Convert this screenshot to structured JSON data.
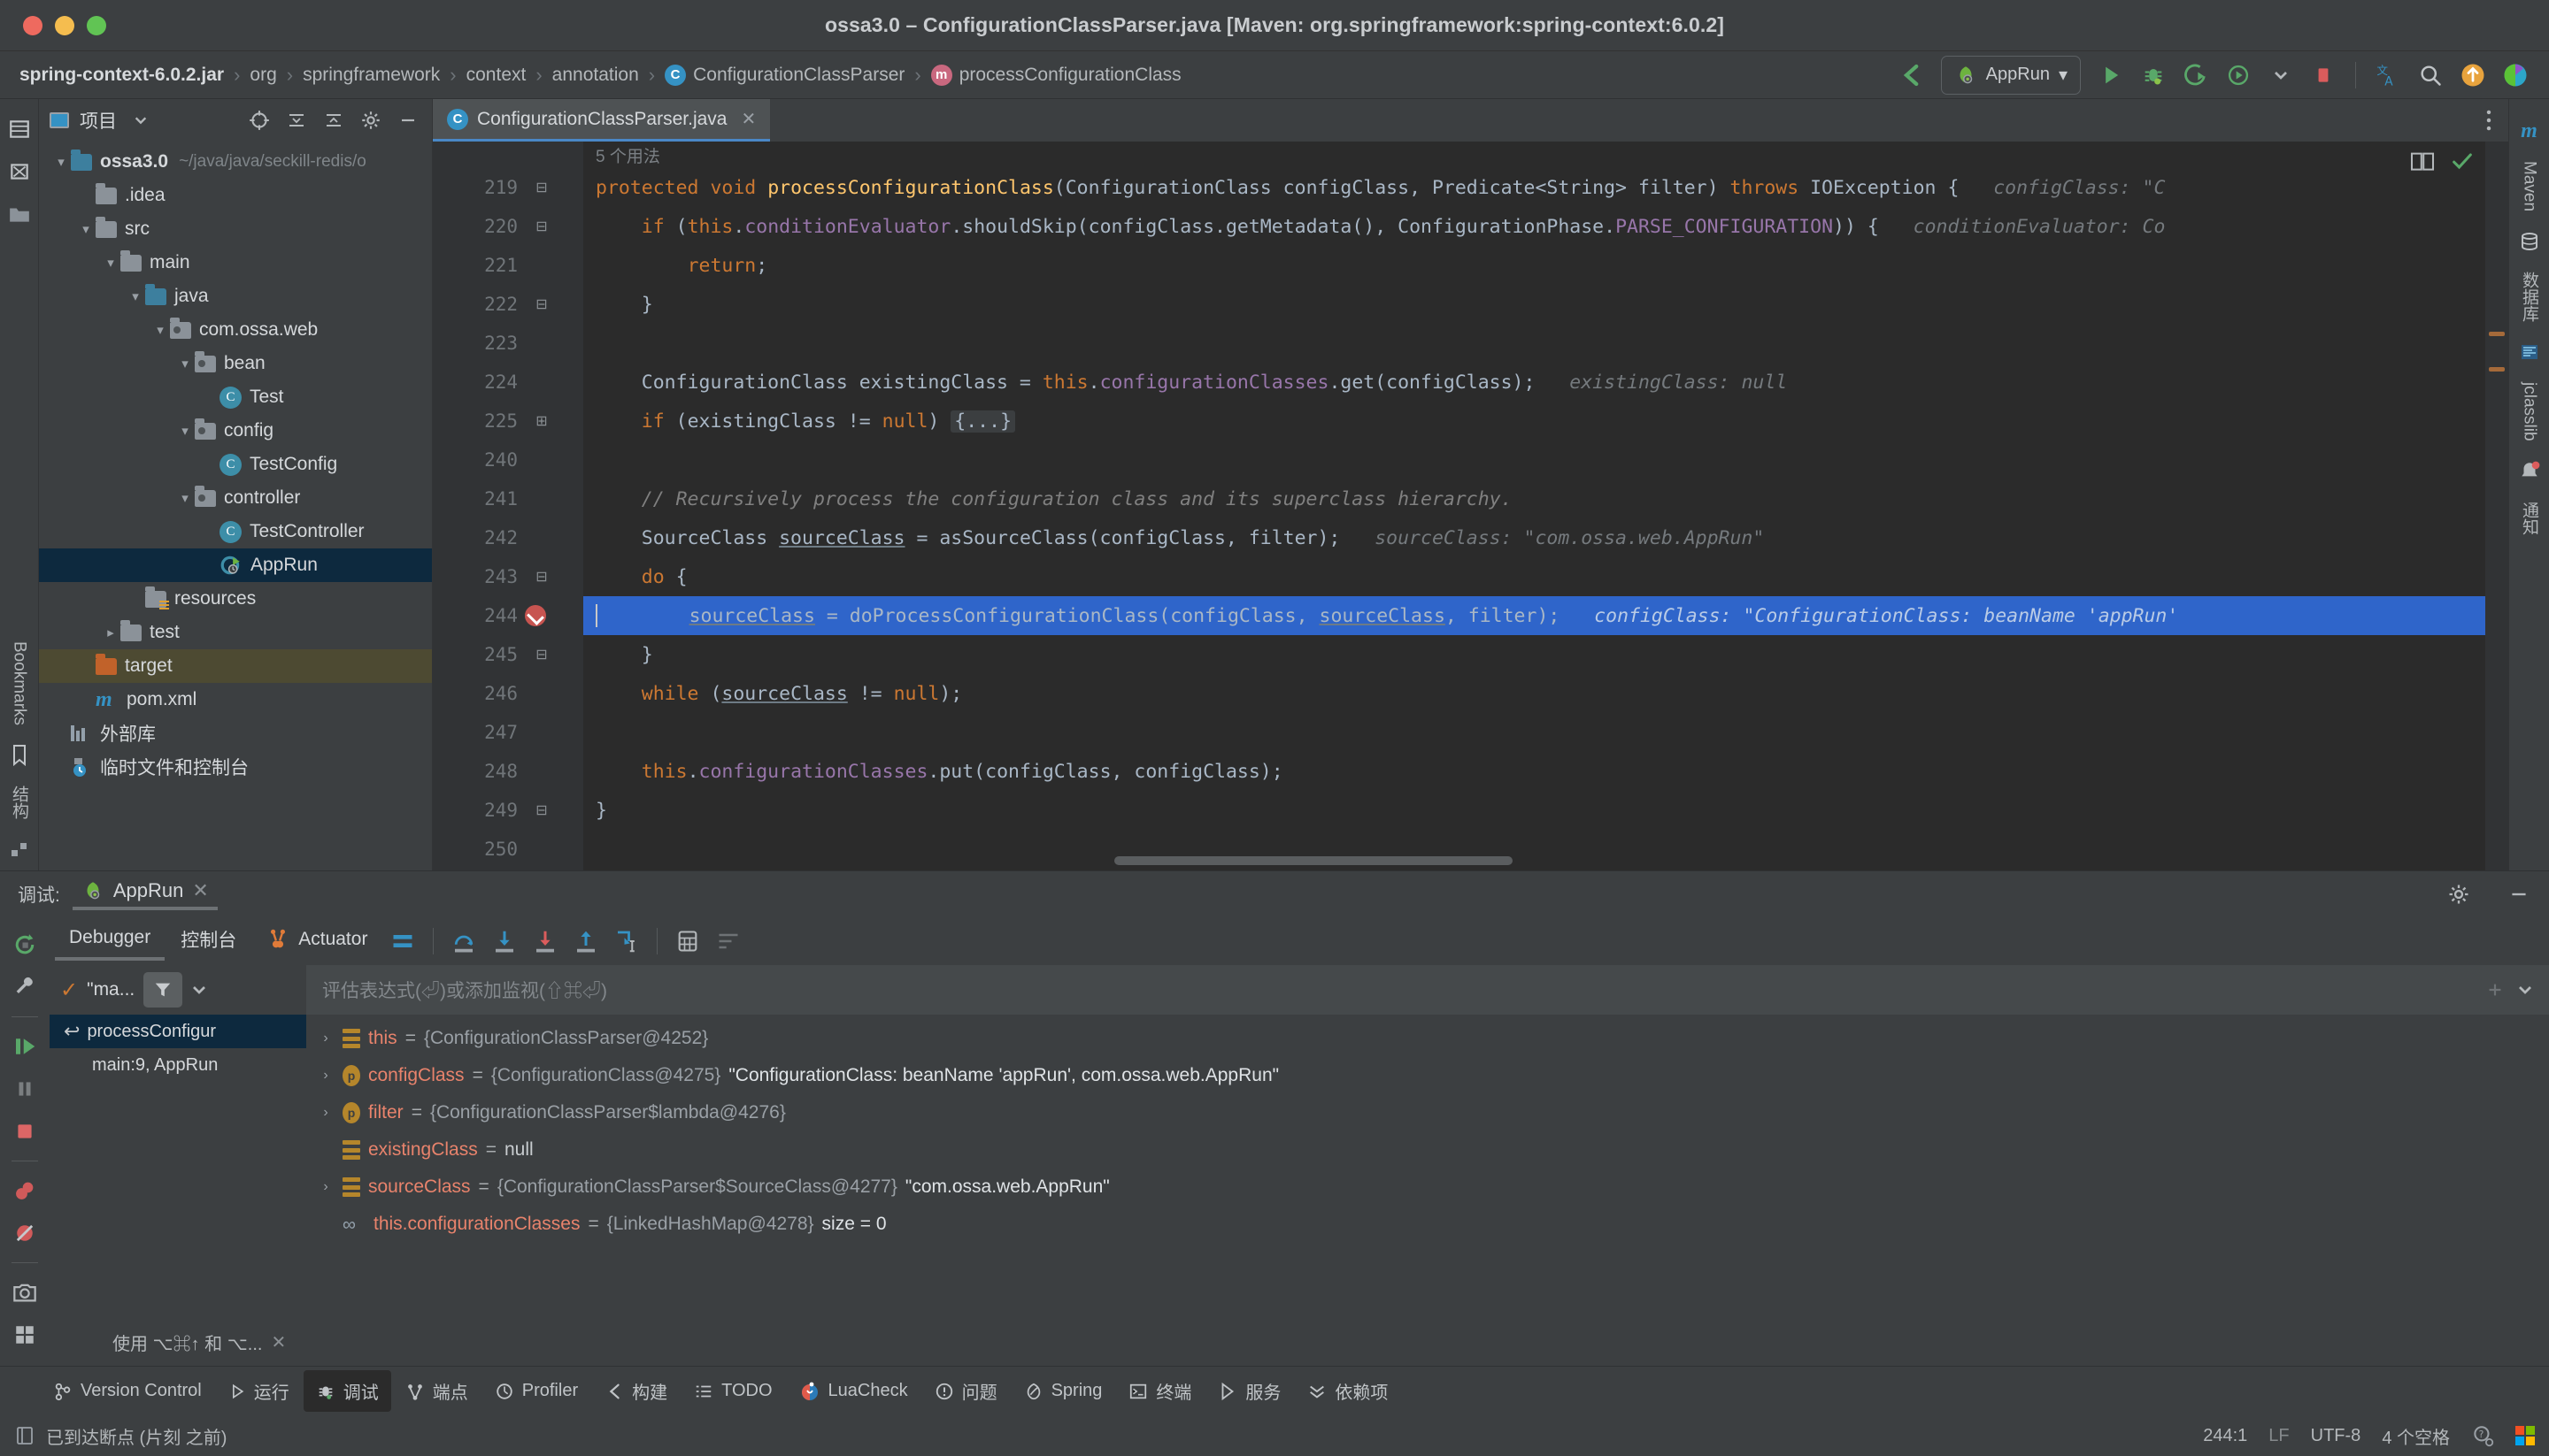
{
  "window": {
    "title": "ossa3.0 – ConfigurationClassParser.java [Maven: org.springframework:spring-context:6.0.2]"
  },
  "breadcrumbs": [
    {
      "label": "spring-context-6.0.2.jar",
      "icon": ""
    },
    {
      "label": "org",
      "icon": ""
    },
    {
      "label": "springframework",
      "icon": ""
    },
    {
      "label": "context",
      "icon": ""
    },
    {
      "label": "annotation",
      "icon": ""
    },
    {
      "label": "ConfigurationClassParser",
      "icon": "class-icon"
    },
    {
      "label": "processConfigurationClass",
      "icon": "method-icon"
    }
  ],
  "toolbar": {
    "run_config": "AppRun",
    "dropdown_caret": "▾",
    "icons": [
      "build-icon",
      "run-icon",
      "debug-icon",
      "run-with-coverage-icon",
      "profiler-icon",
      "stop-icon",
      "translate-icon",
      "search-icon",
      "update-icon",
      "ide-icon"
    ]
  },
  "project_panel": {
    "title": "项目",
    "header_icons": [
      "locate-icon",
      "collapse-all-icon",
      "expand-icon",
      "settings-icon",
      "hide-icon"
    ],
    "tree": [
      {
        "indent": 0,
        "chevron": "▾",
        "icon": "module-icon",
        "label": "ossa3.0",
        "path": "~/java/java/seckill-redis/o",
        "bold": true,
        "state": ""
      },
      {
        "indent": 1,
        "chevron": "",
        "icon": "folder-icon",
        "label": ".idea",
        "path": "",
        "bold": false,
        "state": ""
      },
      {
        "indent": 1,
        "chevron": "▾",
        "icon": "folder-icon",
        "label": "src",
        "path": "",
        "bold": false,
        "state": ""
      },
      {
        "indent": 2,
        "chevron": "▾",
        "icon": "folder-icon",
        "label": "main",
        "path": "",
        "bold": false,
        "state": ""
      },
      {
        "indent": 3,
        "chevron": "▾",
        "icon": "source-folder-icon",
        "label": "java",
        "path": "",
        "bold": false,
        "state": ""
      },
      {
        "indent": 4,
        "chevron": "▾",
        "icon": "package-icon",
        "label": "com.ossa.web",
        "path": "",
        "bold": false,
        "state": ""
      },
      {
        "indent": 5,
        "chevron": "▾",
        "icon": "package-icon",
        "label": "bean",
        "path": "",
        "bold": false,
        "state": ""
      },
      {
        "indent": 6,
        "chevron": "",
        "icon": "class-icon",
        "label": "Test",
        "path": "",
        "bold": false,
        "state": ""
      },
      {
        "indent": 5,
        "chevron": "▾",
        "icon": "package-icon",
        "label": "config",
        "path": "",
        "bold": false,
        "state": ""
      },
      {
        "indent": 6,
        "chevron": "",
        "icon": "class-icon",
        "label": "TestConfig",
        "path": "",
        "bold": false,
        "state": ""
      },
      {
        "indent": 5,
        "chevron": "▾",
        "icon": "package-icon",
        "label": "controller",
        "path": "",
        "bold": false,
        "state": ""
      },
      {
        "indent": 6,
        "chevron": "",
        "icon": "class-icon",
        "label": "TestController",
        "path": "",
        "bold": false,
        "state": ""
      },
      {
        "indent": 6,
        "chevron": "",
        "icon": "spring-run-icon",
        "label": "AppRun",
        "path": "",
        "bold": false,
        "state": "selected"
      },
      {
        "indent": 3,
        "chevron": "",
        "icon": "resources-folder-icon",
        "label": "resources",
        "path": "",
        "bold": false,
        "state": ""
      },
      {
        "indent": 2,
        "chevron": "▸",
        "icon": "folder-icon",
        "label": "test",
        "path": "",
        "bold": false,
        "state": ""
      },
      {
        "indent": 1,
        "chevron": "",
        "icon": "target-folder-icon",
        "label": "target",
        "path": "",
        "bold": false,
        "state": "highlighted"
      },
      {
        "indent": 1,
        "chevron": "",
        "icon": "maven-icon",
        "label": "pom.xml",
        "path": "",
        "bold": false,
        "state": ""
      },
      {
        "indent": 0,
        "chevron": "",
        "icon": "library-icon",
        "label": "外部库",
        "path": "",
        "bold": false,
        "state": ""
      },
      {
        "indent": 0,
        "chevron": "",
        "icon": "scratch-icon",
        "label": "临时文件和控制台",
        "path": "",
        "bold": false,
        "state": ""
      }
    ]
  },
  "left_rail": {
    "items": [
      "project-icon",
      "structure-icon",
      "bookmarks-icon"
    ],
    "bookmarks_label": "Bookmarks",
    "structure_label": "结构"
  },
  "right_rail": {
    "items": [
      {
        "label": "Maven",
        "icon": "maven-icon"
      },
      {
        "label": "数据库",
        "icon": "database-icon"
      },
      {
        "label": "jclasslib",
        "icon": "jclasslib-icon"
      },
      {
        "label": "通知",
        "icon": "notifications-icon"
      }
    ]
  },
  "editor": {
    "tab": {
      "label": "ConfigurationClassParser.java",
      "icon": "class-icon",
      "close": "✕"
    },
    "usages_hint": "5 个用法",
    "lines": [
      {
        "num": "219",
        "fold": "⊟",
        "breakpoint": false,
        "highlight": false,
        "tokens": [
          {
            "t": "kw",
            "s": "protected "
          },
          {
            "t": "kw",
            "s": "void "
          },
          {
            "t": "fn",
            "s": "processConfigurationClass"
          },
          {
            "t": "pl",
            "s": "(ConfigurationClass configClass, Predicate<String> filter) "
          },
          {
            "t": "kw",
            "s": "throws "
          },
          {
            "t": "pl",
            "s": "IOException {"
          }
        ],
        "inline_hint": "configClass: \"C"
      },
      {
        "num": "220",
        "fold": "⊟",
        "breakpoint": false,
        "highlight": false,
        "tokens": [
          {
            "t": "pl",
            "s": "    "
          },
          {
            "t": "kw",
            "s": "if "
          },
          {
            "t": "pl",
            "s": "("
          },
          {
            "t": "kw",
            "s": "this"
          },
          {
            "t": "pl",
            "s": "."
          },
          {
            "t": "fld",
            "s": "conditionEvaluator"
          },
          {
            "t": "pl",
            "s": ".shouldSkip(configClass.getMetadata(), ConfigurationPhase."
          },
          {
            "t": "fldi",
            "s": "PARSE_CONFIGURATION"
          },
          {
            "t": "pl",
            "s": ")) {"
          }
        ],
        "inline_hint": "conditionEvaluator: Co"
      },
      {
        "num": "221",
        "fold": "",
        "breakpoint": false,
        "highlight": false,
        "tokens": [
          {
            "t": "pl",
            "s": "        "
          },
          {
            "t": "kw",
            "s": "return"
          },
          {
            "t": "pl",
            "s": ";"
          }
        ],
        "inline_hint": ""
      },
      {
        "num": "222",
        "fold": "⊟",
        "breakpoint": false,
        "highlight": false,
        "tokens": [
          {
            "t": "pl",
            "s": "    }"
          }
        ],
        "inline_hint": ""
      },
      {
        "num": "223",
        "fold": "",
        "breakpoint": false,
        "highlight": false,
        "tokens": [],
        "inline_hint": ""
      },
      {
        "num": "224",
        "fold": "",
        "breakpoint": false,
        "highlight": false,
        "tokens": [
          {
            "t": "pl",
            "s": "    ConfigurationClass existingClass = "
          },
          {
            "t": "kw",
            "s": "this"
          },
          {
            "t": "pl",
            "s": "."
          },
          {
            "t": "fld",
            "s": "configurationClasses"
          },
          {
            "t": "pl",
            "s": ".get(configClass);"
          }
        ],
        "inline_hint": "existingClass: null"
      },
      {
        "num": "225",
        "fold": "⊞",
        "breakpoint": false,
        "highlight": false,
        "tokens": [
          {
            "t": "pl",
            "s": "    "
          },
          {
            "t": "kw",
            "s": "if "
          },
          {
            "t": "pl",
            "s": "(existingClass != "
          },
          {
            "t": "kw",
            "s": "null"
          },
          {
            "t": "pl",
            "s": ") "
          },
          {
            "t": "fold",
            "s": "{...}"
          }
        ],
        "inline_hint": ""
      },
      {
        "num": "240",
        "fold": "",
        "breakpoint": false,
        "highlight": false,
        "tokens": [],
        "inline_hint": ""
      },
      {
        "num": "241",
        "fold": "",
        "breakpoint": false,
        "highlight": false,
        "tokens": [
          {
            "t": "cm",
            "s": "    // Recursively process the configuration class and its superclass hierarchy."
          }
        ],
        "inline_hint": ""
      },
      {
        "num": "242",
        "fold": "",
        "breakpoint": false,
        "highlight": false,
        "tokens": [
          {
            "t": "pl",
            "s": "    SourceClass "
          },
          {
            "t": "und",
            "s": "sourceClass"
          },
          {
            "t": "pl",
            "s": " = asSourceClass(configClass, filter);"
          }
        ],
        "inline_hint": "sourceClass: \"com.ossa.web.AppRun\""
      },
      {
        "num": "243",
        "fold": "⊟",
        "breakpoint": false,
        "highlight": false,
        "tokens": [
          {
            "t": "pl",
            "s": "    "
          },
          {
            "t": "kw",
            "s": "do"
          },
          {
            "t": "pl",
            "s": " {"
          }
        ],
        "inline_hint": ""
      },
      {
        "num": "244",
        "fold": "",
        "breakpoint": true,
        "highlight": true,
        "tokens": [
          {
            "t": "pl",
            "s": "        "
          },
          {
            "t": "und",
            "s": "sourceClass"
          },
          {
            "t": "pl",
            "s": " = doProcessConfigurationClass(configClass, "
          },
          {
            "t": "und",
            "s": "sourceClass"
          },
          {
            "t": "pl",
            "s": ", filter);"
          }
        ],
        "inline_hint": "configClass: \"ConfigurationClass: beanName 'appRun'"
      },
      {
        "num": "245",
        "fold": "⊟",
        "breakpoint": false,
        "highlight": false,
        "tokens": [
          {
            "t": "pl",
            "s": "    }"
          }
        ],
        "inline_hint": ""
      },
      {
        "num": "246",
        "fold": "",
        "breakpoint": false,
        "highlight": false,
        "tokens": [
          {
            "t": "pl",
            "s": "    "
          },
          {
            "t": "kw",
            "s": "while "
          },
          {
            "t": "pl",
            "s": "("
          },
          {
            "t": "und",
            "s": "sourceClass"
          },
          {
            "t": "pl",
            "s": " != "
          },
          {
            "t": "kw",
            "s": "null"
          },
          {
            "t": "pl",
            "s": ");"
          }
        ],
        "inline_hint": ""
      },
      {
        "num": "247",
        "fold": "",
        "breakpoint": false,
        "highlight": false,
        "tokens": [],
        "inline_hint": ""
      },
      {
        "num": "248",
        "fold": "",
        "breakpoint": false,
        "highlight": false,
        "tokens": [
          {
            "t": "pl",
            "s": "    "
          },
          {
            "t": "kw",
            "s": "this"
          },
          {
            "t": "pl",
            "s": "."
          },
          {
            "t": "fld",
            "s": "configurationClasses"
          },
          {
            "t": "pl",
            "s": ".put(configClass, configClass);"
          }
        ],
        "inline_hint": ""
      },
      {
        "num": "249",
        "fold": "⊟",
        "breakpoint": false,
        "highlight": false,
        "tokens": [
          {
            "t": "pl",
            "s": "}"
          }
        ],
        "inline_hint": ""
      },
      {
        "num": "250",
        "fold": "",
        "breakpoint": false,
        "highlight": false,
        "tokens": [],
        "inline_hint": ""
      }
    ]
  },
  "debug": {
    "label": "调试:",
    "session_tab": "AppRun",
    "session_close": "✕",
    "tabs": [
      {
        "label": "Debugger",
        "active": true
      },
      {
        "label": "控制台",
        "active": false
      },
      {
        "label": "Actuator",
        "active": false,
        "icon": "actuator-icon"
      }
    ],
    "thread_chip": "\"ma...",
    "eval_placeholder": "评估表达式(⏎)或添加监视(⇧⌘⏎)",
    "frames": [
      {
        "label": "processConfigur",
        "icon": "frame-icon",
        "selected": true
      },
      {
        "label": "main:9, AppRun",
        "icon": "",
        "selected": false
      }
    ],
    "variables": [
      {
        "chevron": "›",
        "icon": "field-icon",
        "name": "this",
        "eq": "=",
        "ref": "{ConfigurationClassParser@4252}",
        "value": ""
      },
      {
        "chevron": "›",
        "icon": "param-icon",
        "name": "configClass",
        "eq": "=",
        "ref": "{ConfigurationClass@4275}",
        "value": "\"ConfigurationClass: beanName 'appRun', com.ossa.web.AppRun\""
      },
      {
        "chevron": "›",
        "icon": "param-icon",
        "name": "filter",
        "eq": "=",
        "ref": "{ConfigurationClassParser$lambda@4276}",
        "value": ""
      },
      {
        "chevron": "",
        "icon": "field-icon",
        "name": "existingClass",
        "eq": "=",
        "ref": "",
        "value": "null"
      },
      {
        "chevron": "›",
        "icon": "field-icon",
        "name": "sourceClass",
        "eq": "=",
        "ref": "{ConfigurationClassParser$SourceClass@4277}",
        "value": "\"com.ossa.web.AppRun\""
      },
      {
        "chevron": "",
        "icon": "watch-icon",
        "name": "this.configurationClasses",
        "eq": "=",
        "ref": "{LinkedHashMap@4278}",
        "value": "size = 0"
      }
    ],
    "footer_chip": "使用 ⌥⌘↑ 和 ⌥...",
    "footer_close": "✕"
  },
  "toolwindow_bar": [
    {
      "label": "Version Control",
      "icon": "vcs-icon",
      "active": false
    },
    {
      "label": "运行",
      "icon": "run-icon",
      "active": false
    },
    {
      "label": "调试",
      "icon": "debug-icon",
      "active": true
    },
    {
      "label": "端点",
      "icon": "endpoints-icon",
      "active": false
    },
    {
      "label": "Profiler",
      "icon": "profiler-icon",
      "active": false
    },
    {
      "label": "构建",
      "icon": "build-icon",
      "active": false
    },
    {
      "label": "TODO",
      "icon": "todo-icon",
      "active": false
    },
    {
      "label": "LuaCheck",
      "icon": "luacheck-icon",
      "active": false
    },
    {
      "label": "问题",
      "icon": "problems-icon",
      "active": false
    },
    {
      "label": "Spring",
      "icon": "spring-icon",
      "active": false
    },
    {
      "label": "终端",
      "icon": "terminal-icon",
      "active": false
    },
    {
      "label": "服务",
      "icon": "services-icon",
      "active": false
    },
    {
      "label": "依赖项",
      "icon": "dependencies-icon",
      "active": false
    }
  ],
  "status_bar": {
    "message": "已到达断点 (片刻 之前)",
    "caret_position": "244:1",
    "line_separator": "LF",
    "encoding": "UTF-8",
    "indent": "4 个空格",
    "right_icons": [
      "inspections-icon",
      "ms-logo-icon"
    ]
  }
}
